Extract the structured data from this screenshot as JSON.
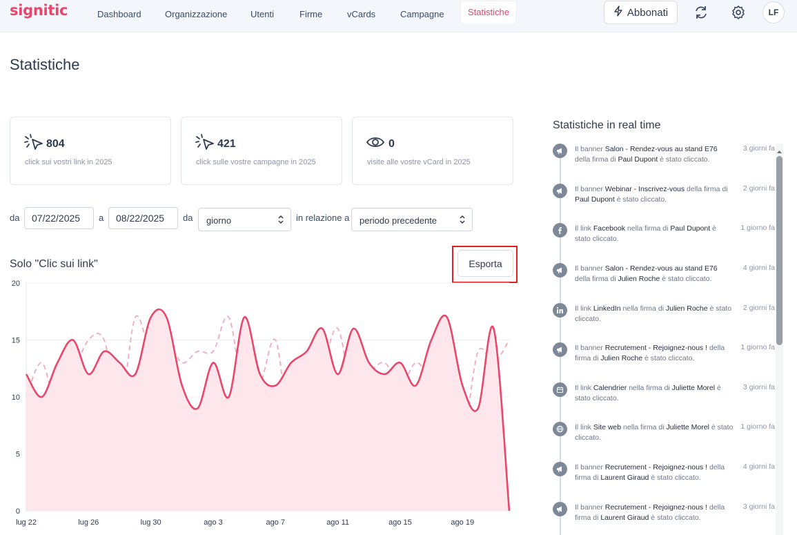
{
  "brand": {
    "logo": "signitic",
    "accent": "#e8466b"
  },
  "nav": [
    {
      "label": "Dashboard"
    },
    {
      "label": "Organizzazione"
    },
    {
      "label": "Utenti"
    },
    {
      "label": "Firme"
    },
    {
      "label": "vCards"
    },
    {
      "label": "Campagne"
    },
    {
      "label": "Statistiche",
      "active": true
    }
  ],
  "header": {
    "subscribe_label": "Abbonati",
    "refresh_icon": "refresh-icon",
    "settings_icon": "gear-icon",
    "avatar": "LF"
  },
  "page": {
    "title": "Statistiche"
  },
  "stats": [
    {
      "icon": "click-icon",
      "value": "804",
      "label": "click sui vostri link in 2025"
    },
    {
      "icon": "click-icon",
      "value": "421",
      "label": "click sulle vostre campagne in 2025"
    },
    {
      "icon": "eye-icon",
      "value": "0",
      "label": "visite alle vostre vCard in 2025"
    }
  ],
  "filters": {
    "from_label": "da",
    "from_date": "07/22/2025",
    "to_label": "a",
    "to_date": "08/22/2025",
    "by_label": "da",
    "granularity": "giorno",
    "relation_label": "in relazione a",
    "comparison": "periodo precedente"
  },
  "chart_section": {
    "title": "Solo \"Clic sui link\"",
    "export_label": "Esporta"
  },
  "chart_data": {
    "type": "area",
    "title": "",
    "xlabel": "",
    "ylabel": "",
    "ylim": [
      0,
      20
    ],
    "yticks": [
      0,
      5,
      10,
      15,
      20
    ],
    "x": [
      "lug 22",
      "lug 23",
      "lug 24",
      "lug 25",
      "lug 26",
      "lug 27",
      "lug 28",
      "lug 29",
      "lug 30",
      "lug 31",
      "ago 1",
      "ago 2",
      "ago 3",
      "ago 4",
      "ago 5",
      "ago 6",
      "ago 7",
      "ago 8",
      "ago 9",
      "ago 10",
      "ago 11",
      "ago 12",
      "ago 13",
      "ago 14",
      "ago 15",
      "ago 16",
      "ago 17",
      "ago 18",
      "ago 19",
      "ago 20",
      "ago 21",
      "ago 22"
    ],
    "xticks": [
      "lug 22",
      "lug 26",
      "lug 30",
      "ago 3",
      "ago 7",
      "ago 11",
      "ago 15",
      "ago 19"
    ],
    "grid": true,
    "series": [
      {
        "style": "solid",
        "fill": true,
        "color": "#e8466b",
        "values": [
          12,
          10,
          13,
          15,
          12,
          14,
          13,
          12,
          17,
          17,
          11,
          9,
          13,
          10,
          17,
          12,
          11,
          13,
          14,
          16,
          12,
          16,
          13,
          12,
          13,
          11,
          15,
          17,
          11,
          9,
          16,
          0
        ]
      },
      {
        "style": "dashed",
        "fill": false,
        "color": "#f3a9bb",
        "values": [
          10,
          13,
          9,
          12,
          15,
          15,
          9,
          17,
          14,
          15,
          13,
          14,
          14,
          17,
          10,
          11,
          15,
          7,
          14,
          13,
          16,
          10,
          12,
          13,
          11,
          13,
          12,
          14,
          7,
          14,
          13,
          15
        ]
      }
    ]
  },
  "realtime": {
    "title": "Statistiche in real time",
    "items": [
      {
        "icon": "megaphone-icon",
        "parts": [
          "Il banner ",
          "Salon - Rendez-vous au stand E76",
          " della firma di ",
          "Paul Dupont",
          " è stato cliccato."
        ],
        "time": "3 giorni fa"
      },
      {
        "icon": "megaphone-icon",
        "parts": [
          "Il banner ",
          "Webinar - Inscrivez-vous",
          " della firma di ",
          "Paul Dupont",
          " è stato cliccato."
        ],
        "time": "2 giorni fa"
      },
      {
        "icon": "facebook-icon",
        "parts": [
          "Il link ",
          "Facebook",
          " nella firma di ",
          "Paul Dupont",
          " è stato cliccato."
        ],
        "time": "1 giorno fa"
      },
      {
        "icon": "megaphone-icon",
        "parts": [
          "Il banner ",
          "Salon - Rendez-vous au stand E76",
          " della firma di ",
          "Julien Roche",
          " è stato cliccato."
        ],
        "time": "4 giorni fa"
      },
      {
        "icon": "linkedin-icon",
        "parts": [
          "Il link ",
          "LinkedIn",
          " nella firma di ",
          "Julien Roche",
          " è stato cliccato."
        ],
        "time": "2 giorni fa"
      },
      {
        "icon": "megaphone-icon",
        "parts": [
          "Il banner ",
          "Recrutement - Rejoignez-nous !",
          " della firma di ",
          "Julien Roche",
          " è stato cliccato."
        ],
        "time": "1 giorno fa"
      },
      {
        "icon": "calendar-icon",
        "parts": [
          "Il link ",
          "Calendrier",
          " nella firma di ",
          "Juliette Morel",
          " è stato cliccato."
        ],
        "time": "3 giorni fa"
      },
      {
        "icon": "globe-icon",
        "parts": [
          "Il link ",
          "Site web",
          " nella firma di ",
          "Juliette Morel",
          " è stato cliccato."
        ],
        "time": "1 giorno fa"
      },
      {
        "icon": "megaphone-icon",
        "parts": [
          "Il banner ",
          "Recrutement - Rejoignez-nous !",
          " della firma di ",
          "Laurent Giraud",
          " è stato cliccato."
        ],
        "time": "4 giorni fa"
      },
      {
        "icon": "megaphone-icon",
        "parts": [
          "Il banner ",
          "Recrutement - Rejoignez-nous !",
          " della firma di ",
          "Laurent Giraud",
          " è stato cliccato."
        ],
        "time": "3 giorni fa"
      }
    ]
  }
}
